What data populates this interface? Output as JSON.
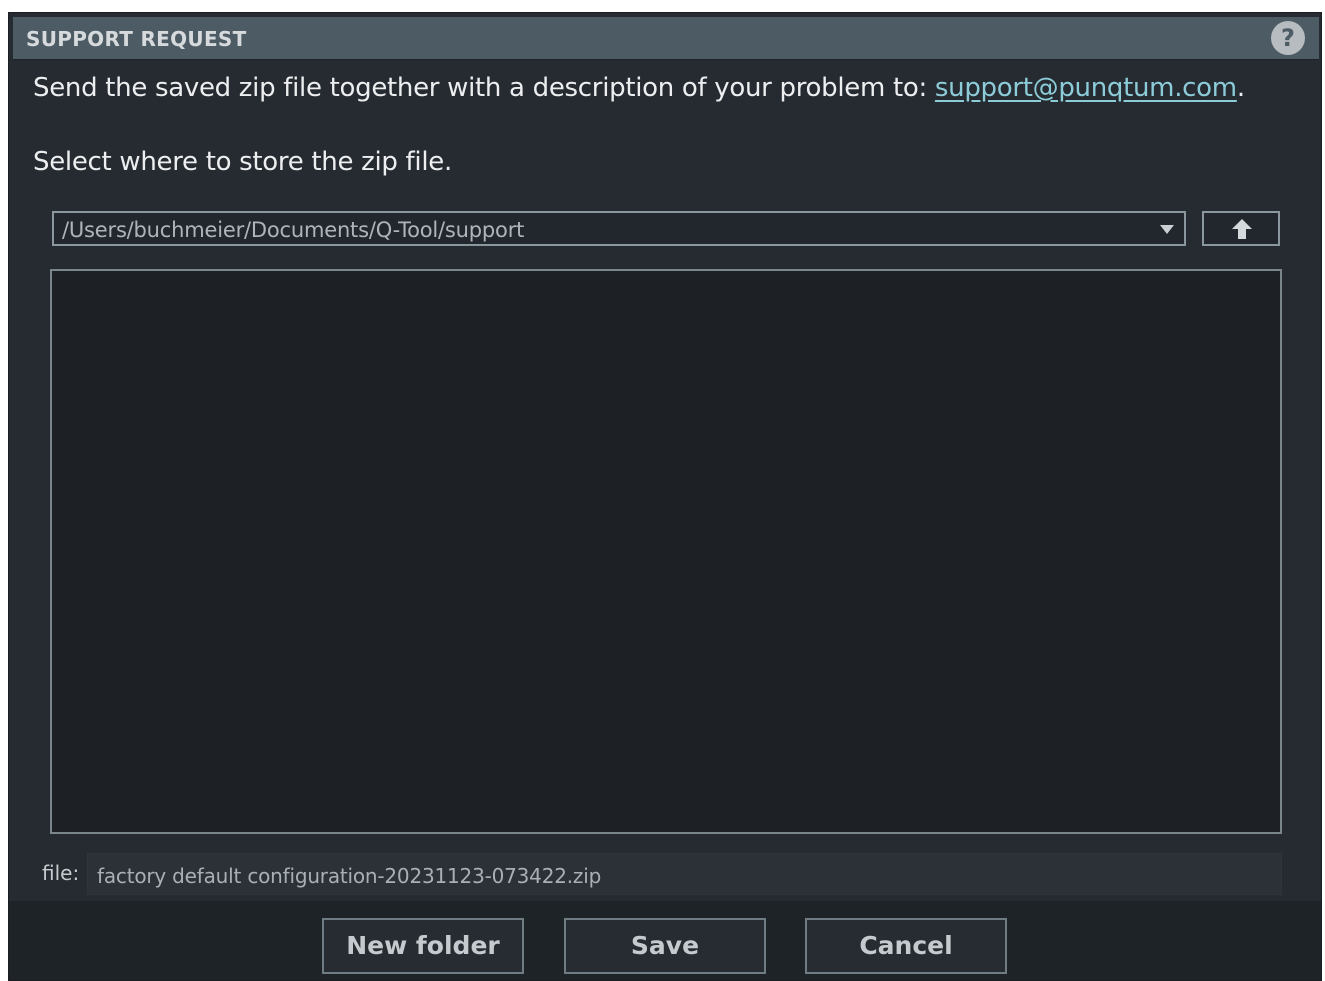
{
  "dialog": {
    "title": "SUPPORT REQUEST",
    "help_icon": "?"
  },
  "instruction": {
    "text": "Send the saved zip file together with a description of your problem to: ",
    "email": "support@punqtum.com",
    "suffix": "."
  },
  "select_label": "Select where to store the zip file.",
  "path": {
    "value": "/Users/buchmeier/Documents/Q-Tool/support"
  },
  "file": {
    "label": "file:",
    "value": "factory default configuration-20231123-073422.zip"
  },
  "buttons": {
    "new_folder": "New folder",
    "save": "Save",
    "cancel": "Cancel"
  },
  "icons": {
    "help": "help-icon",
    "dropdown": "chevron-down-icon",
    "up": "arrow-up-icon"
  },
  "colors": {
    "background": "#262b31",
    "titlebar": "#4d5b64",
    "link": "#8ccbd8"
  }
}
